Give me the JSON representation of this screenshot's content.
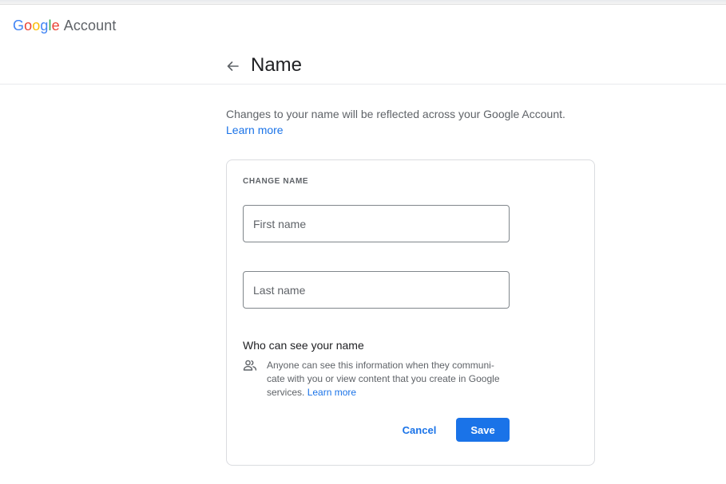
{
  "header": {
    "brand_letters": [
      "G",
      "o",
      "o",
      "g",
      "l",
      "e"
    ],
    "brand_product": "Account"
  },
  "page": {
    "title": "Name",
    "intro_text": "Changes to your name will be reflected across your Google Account. ",
    "intro_link": "Learn more"
  },
  "card": {
    "heading": "CHANGE NAME",
    "first_name": {
      "value": "",
      "placeholder": "First name"
    },
    "last_name": {
      "value": "",
      "placeholder": "Last name"
    },
    "visibility": {
      "title": "Who can see your name",
      "icon": "people-icon",
      "description": "Anyone can see this information when they communi-cate with you or view content that you create in Google services. ",
      "link": "Learn more"
    },
    "cancel_label": "Cancel",
    "save_label": "Save"
  },
  "colors": {
    "accent": "#1a73e8",
    "google_blue": "#4285f4",
    "google_red": "#ea4335",
    "google_yellow": "#fbbc04",
    "google_green": "#34a853"
  }
}
